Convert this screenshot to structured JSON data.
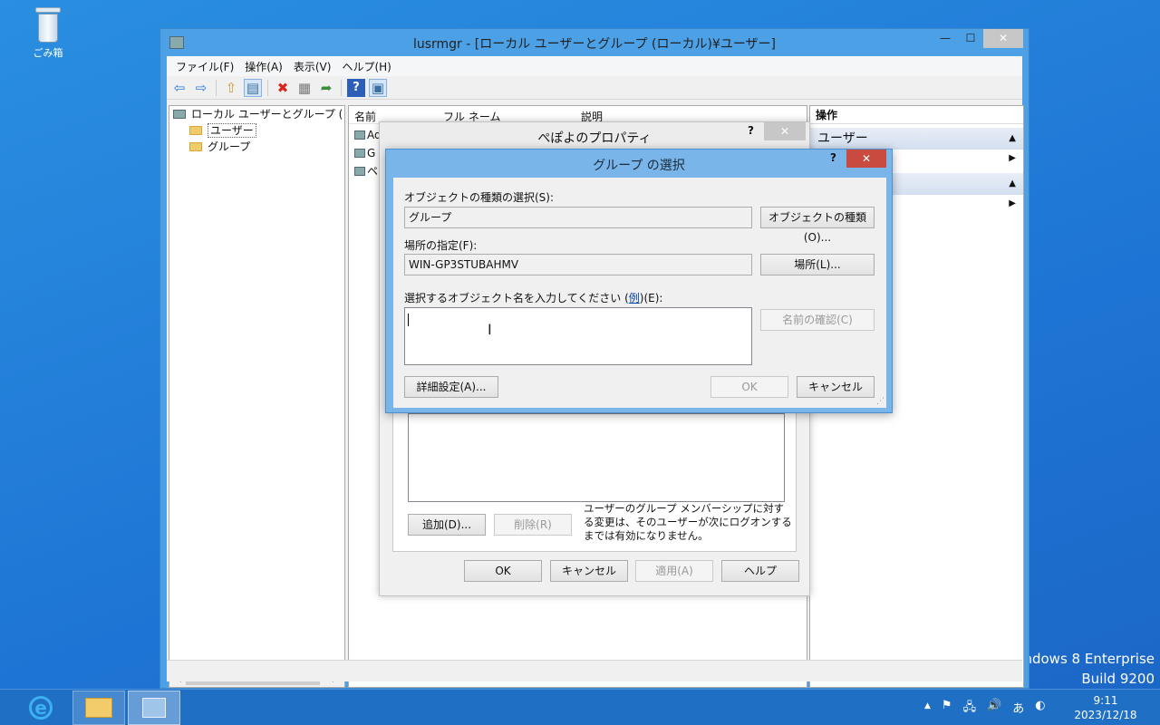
{
  "desktop": {
    "recycle_bin_label": "ごみ箱",
    "watermark_line1": "ndows 8 Enterprise",
    "watermark_line2": "Build 9200"
  },
  "main_window": {
    "title": "lusrmgr - [ローカル ユーザーとグループ (ローカル)¥ユーザー]",
    "min_glyph": "—",
    "max_glyph": "☐",
    "close_glyph": "✕",
    "menu": [
      "ファイル(F)",
      "操作(A)",
      "表示(V)",
      "ヘルプ(H)"
    ],
    "toolbar_icons": [
      "back-arrow-icon",
      "forward-arrow-icon",
      "up-folder-icon",
      "show-tree-icon",
      "delete-icon",
      "properties-icon",
      "export-icon",
      "help-icon",
      "console-icon"
    ],
    "toolbar_glyphs": {
      "back": "⇦",
      "forward": "⇨",
      "up": "⇧",
      "tree": "▤",
      "delete": "✖",
      "props": "▦",
      "export": "➦",
      "help": "?",
      "console": "▣"
    },
    "tree": {
      "root": "ローカル ユーザーとグループ (ローカル)",
      "items": [
        "ユーザー",
        "グループ"
      ]
    },
    "list_columns": [
      "名前",
      "フル ネーム",
      "説明"
    ],
    "list_rows": [
      "Ad",
      "G",
      "ペ"
    ],
    "actions": {
      "header": "操作",
      "section1": "ユーザー",
      "section2": ""
    },
    "scroll_left": "<",
    "scroll_right": ">"
  },
  "properties_dialog": {
    "title": "ぺぽよのプロパティ",
    "help_glyph": "?",
    "close_glyph": "✕",
    "add_button": "追加(D)...",
    "remove_button": "削除(R)",
    "note": "ユーザーのグループ メンバーシップに対する変更は、そのユーザーが次にログオンするまでは有効になりません。",
    "ok": "OK",
    "cancel": "キャンセル",
    "apply": "適用(A)",
    "help": "ヘルプ"
  },
  "group_dialog": {
    "title": "グループ の選択",
    "help_glyph": "?",
    "close_glyph": "✕",
    "object_type_label": "オブジェクトの種類の選択(S):",
    "object_type_value": "グループ",
    "object_type_button": "オブジェクトの種類(O)...",
    "location_label": "場所の指定(F):",
    "location_value": "WIN-GP3STUBAHMV",
    "location_button": "場所(L)...",
    "names_label_pre": "選択するオブジェクト名を入力してください (",
    "names_label_link": "例",
    "names_label_post": ")(E):",
    "names_value": "",
    "check_names_button": "名前の確認(C)",
    "advanced_button": "詳細設定(A)...",
    "ok": "OK",
    "cancel": "キャンセル"
  },
  "taskbar": {
    "apps": [
      "internet-explorer",
      "file-explorer",
      "computer-management"
    ],
    "tray": {
      "chevron": "▲",
      "flag": "⚑",
      "network": "🖧",
      "volume": "🔊",
      "ime": "あ",
      "ime_mode": "◐"
    },
    "time": "9:11",
    "date": "2023/12/18"
  }
}
